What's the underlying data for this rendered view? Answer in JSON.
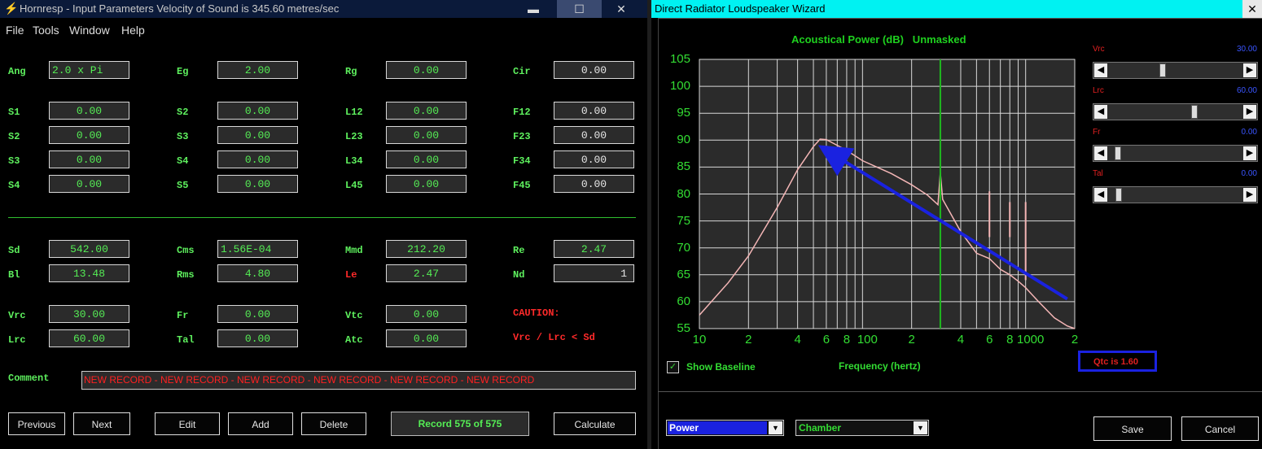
{
  "left": {
    "title": "Hornresp - Input Parameters   Velocity of Sound is 345.60 metres/sec",
    "menu": [
      "File",
      "Tools",
      "Window",
      "Help"
    ],
    "rows1": [
      {
        "label": "Ang",
        "value": "2.0 x Pi"
      },
      {
        "label": "Eg",
        "value": "2.00"
      },
      {
        "label": "Rg",
        "value": "0.00"
      },
      {
        "label": "Cir",
        "value": "0.00"
      }
    ],
    "grid": [
      [
        {
          "label": "S1",
          "value": "0.00"
        },
        {
          "label": "S2",
          "value": "0.00"
        },
        {
          "label": "L12",
          "value": "0.00"
        },
        {
          "label": "F12",
          "value": "0.00"
        }
      ],
      [
        {
          "label": "S2",
          "value": "0.00"
        },
        {
          "label": "S3",
          "value": "0.00"
        },
        {
          "label": "L23",
          "value": "0.00"
        },
        {
          "label": "F23",
          "value": "0.00"
        }
      ],
      [
        {
          "label": "S3",
          "value": "0.00"
        },
        {
          "label": "S4",
          "value": "0.00"
        },
        {
          "label": "L34",
          "value": "0.00"
        },
        {
          "label": "F34",
          "value": "0.00"
        }
      ],
      [
        {
          "label": "S4",
          "value": "0.00"
        },
        {
          "label": "S5",
          "value": "0.00"
        },
        {
          "label": "L45",
          "value": "0.00"
        },
        {
          "label": "F45",
          "value": "0.00"
        }
      ]
    ],
    "driver": [
      [
        {
          "label": "Sd",
          "value": "542.00"
        },
        {
          "label": "Cms",
          "value": "1.56E-04"
        },
        {
          "label": "Mmd",
          "value": "212.20"
        },
        {
          "label": "Re",
          "value": "2.47"
        }
      ],
      [
        {
          "label": "Bl",
          "value": "13.48"
        },
        {
          "label": "Rms",
          "value": "4.80"
        },
        {
          "label": "Le",
          "value": "2.47"
        },
        {
          "label": "Nd",
          "value": "1"
        }
      ]
    ],
    "chamber": [
      [
        {
          "label": "Vrc",
          "value": "30.00"
        },
        {
          "label": "Fr",
          "value": "0.00"
        },
        {
          "label": "Vtc",
          "value": "0.00"
        }
      ],
      [
        {
          "label": "Lrc",
          "value": "60.00"
        },
        {
          "label": "Tal",
          "value": "0.00"
        },
        {
          "label": "Atc",
          "value": "0.00"
        }
      ]
    ],
    "caution": "CAUTION:",
    "caution_detail": "Vrc / Lrc < Sd",
    "comment_label": "Comment",
    "comment": "NEW RECORD - NEW RECORD - NEW RECORD - NEW RECORD - NEW RECORD - NEW RECORD",
    "buttons": {
      "previous": "Previous",
      "next": "Next",
      "edit": "Edit",
      "add": "Add",
      "delete": "Delete",
      "calculate": "Calculate"
    },
    "record": "Record 575 of 575"
  },
  "right": {
    "title": "Direct Radiator Loudspeaker Wizard",
    "sliders": [
      {
        "label": "Vrc",
        "value": "30.00",
        "pos": 0.4
      },
      {
        "label": "Lrc",
        "value": "60.00",
        "pos": 0.65
      },
      {
        "label": "Fr",
        "value": "0.00",
        "pos": 0.05
      },
      {
        "label": "Tal",
        "value": "0.00",
        "pos": 0.06
      }
    ],
    "show_baseline": "Show Baseline",
    "xlabel": "Frequency (hertz)",
    "qtc": "Qtc is 1.60",
    "select_left": "Power",
    "select_right": "Chamber",
    "save": "Save",
    "cancel": "Cancel"
  },
  "chart_data": {
    "type": "line",
    "title": "Acoustical Power (dB)   Unmasked",
    "xlabel": "Frequency (hertz)",
    "ylabel": "",
    "xscale": "log",
    "xlim": [
      10,
      2000
    ],
    "ylim": [
      55,
      105
    ],
    "yticks": [
      55,
      60,
      65,
      70,
      75,
      80,
      85,
      90,
      95,
      100,
      105
    ],
    "xtick_labels": [
      "10",
      "2",
      "4",
      "6",
      "8",
      "100",
      "2",
      "4",
      "6",
      "8",
      "1000",
      "2"
    ],
    "grid": true,
    "series": [
      {
        "color": "#f4b6b6",
        "x": [
          10,
          15,
          20,
          30,
          40,
          50,
          55,
          60,
          80,
          100,
          150,
          200,
          250,
          290,
          300,
          310,
          400,
          500,
          600,
          700,
          800,
          900,
          1000,
          1200,
          1500,
          1800,
          2000
        ],
        "y": [
          57.5,
          63.5,
          68.5,
          77.5,
          84.5,
          88.8,
          90.2,
          90.1,
          88.1,
          86.2,
          83.8,
          81.7,
          79.8,
          78,
          84,
          79,
          73,
          69,
          68,
          66,
          65,
          63.8,
          62.6,
          60,
          57,
          55.5,
          55
        ]
      }
    ],
    "markers": [
      {
        "x": 300,
        "color": "#1fb81f"
      }
    ],
    "arrow": {
      "color": "#1a22e0",
      "from": [
        1800,
        60.5
      ],
      "to": [
        65,
        87.5
      ]
    }
  }
}
